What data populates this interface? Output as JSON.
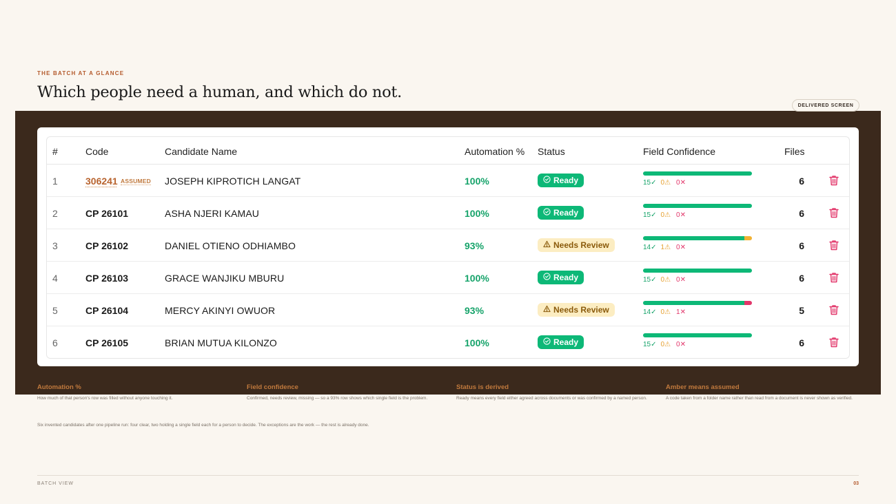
{
  "header": {
    "eyebrow": "THE BATCH AT A GLANCE",
    "headline": "Which people need a human, and which do not.",
    "pill": "DELIVERED SCREEN"
  },
  "table": {
    "columns": [
      "#",
      "Code",
      "Candidate Name",
      "Automation %",
      "Status",
      "Field Confidence",
      "Files"
    ],
    "rows": [
      {
        "num": "1",
        "code": "306241",
        "assumed_tag": "ASSUMED",
        "name": "JOSEPH KIPROTICH LANGAT",
        "automation": "100%",
        "status": "Ready",
        "ok": "15✓",
        "warn": "0⚠",
        "miss": "0✕",
        "ok_n": 15,
        "warn_n": 0,
        "miss_n": 0,
        "files": "6"
      },
      {
        "num": "2",
        "code": "CP 26101",
        "assumed_tag": "",
        "name": "ASHA NJERI KAMAU",
        "automation": "100%",
        "status": "Ready",
        "ok": "15✓",
        "warn": "0⚠",
        "miss": "0✕",
        "ok_n": 15,
        "warn_n": 0,
        "miss_n": 0,
        "files": "6"
      },
      {
        "num": "3",
        "code": "CP 26102",
        "assumed_tag": "",
        "name": "DANIEL OTIENO ODHIAMBO",
        "automation": "93%",
        "status": "Needs Review",
        "ok": "14✓",
        "warn": "1⚠",
        "miss": "0✕",
        "ok_n": 14,
        "warn_n": 1,
        "miss_n": 0,
        "files": "6"
      },
      {
        "num": "4",
        "code": "CP 26103",
        "assumed_tag": "",
        "name": "GRACE WANJIKU MBURU",
        "automation": "100%",
        "status": "Ready",
        "ok": "15✓",
        "warn": "0⚠",
        "miss": "0✕",
        "ok_n": 15,
        "warn_n": 0,
        "miss_n": 0,
        "files": "6"
      },
      {
        "num": "5",
        "code": "CP 26104",
        "assumed_tag": "",
        "name": "MERCY AKINYI OWUOR",
        "automation": "93%",
        "status": "Needs Review",
        "ok": "14✓",
        "warn": "0⚠",
        "miss": "1✕",
        "ok_n": 14,
        "warn_n": 0,
        "miss_n": 1,
        "files": "5"
      },
      {
        "num": "6",
        "code": "CP 26105",
        "assumed_tag": "",
        "name": "BRIAN MUTUA KILONZO",
        "automation": "100%",
        "status": "Ready",
        "ok": "15✓",
        "warn": "0⚠",
        "miss": "0✕",
        "ok_n": 15,
        "warn_n": 0,
        "miss_n": 0,
        "files": "6"
      }
    ]
  },
  "notes": [
    {
      "title": "Automation %",
      "body": "How much of that person's row was filled without anyone touching it."
    },
    {
      "title": "Field confidence",
      "body": "Confirmed, needs review, missing — so a 93% row shows which single field is the problem."
    },
    {
      "title": "Status is derived",
      "body": "Ready means every field either agreed across documents or was confirmed by a named person."
    },
    {
      "title": "Amber means assumed",
      "body": "A code taken from a folder name rather than read from a document is never shown as verified."
    }
  ],
  "footnote": "Six invented candidates after one pipeline run: four clear, two holding a single field each for a person to decide. The exceptions are the work — the rest is already done.",
  "footer": {
    "left": "BATCH VIEW",
    "page": "03"
  },
  "colors": {
    "ok": "#0DB877",
    "warn": "#F2B233",
    "miss": "#E2366A",
    "accent": "#B45A2C",
    "band": "#3B291C"
  },
  "icons": {
    "ready": "check-circle-icon",
    "review": "warning-triangle-icon",
    "delete": "trash-icon"
  }
}
